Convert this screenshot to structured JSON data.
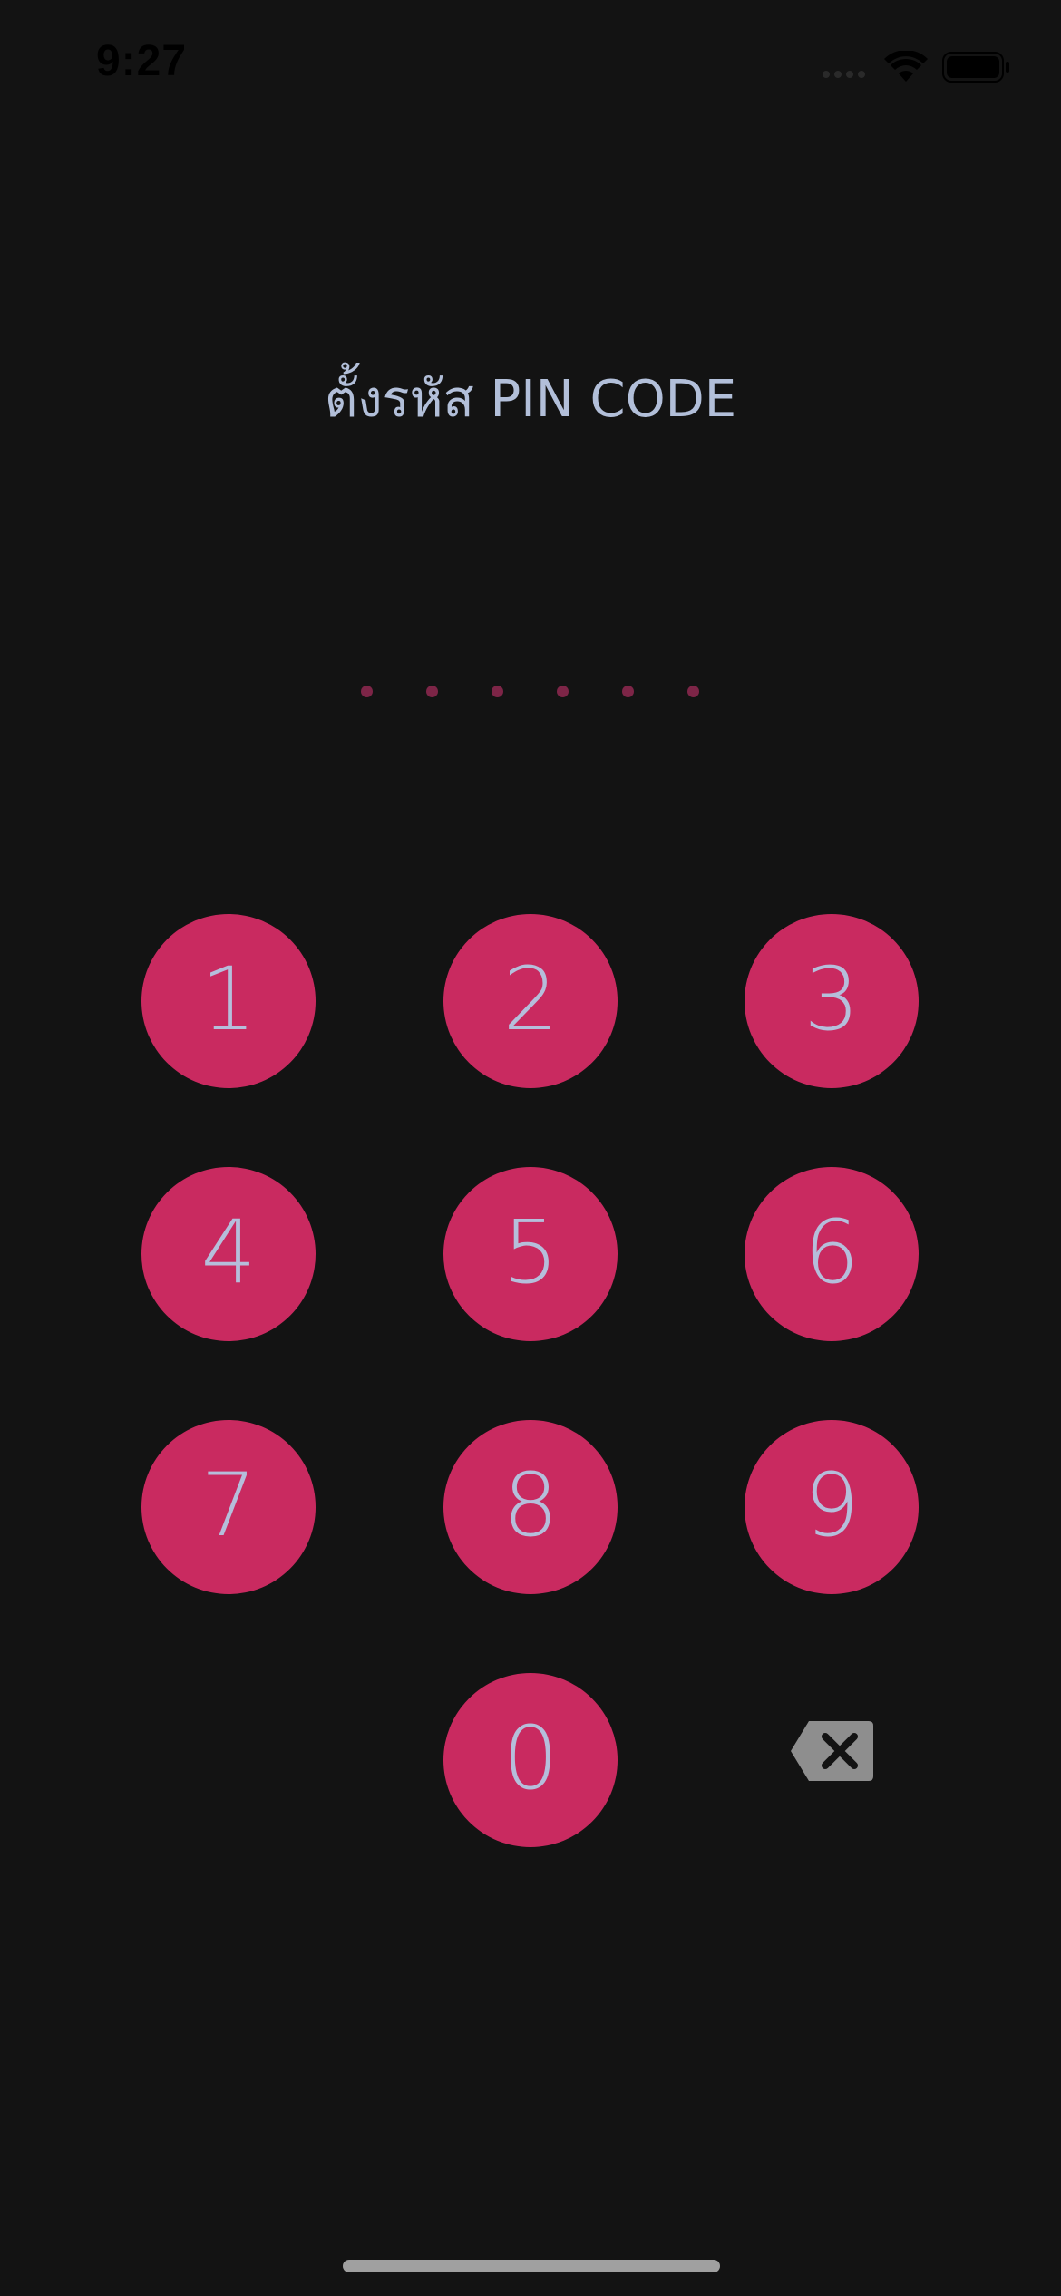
{
  "status_bar": {
    "time": "9:27",
    "icons": [
      "signal-icon",
      "wifi-icon",
      "battery-icon"
    ]
  },
  "title": "ตั้งรหัส PIN CODE",
  "pin": {
    "length": 6,
    "entered": 0
  },
  "keypad": {
    "keys": [
      "1",
      "2",
      "3",
      "4",
      "5",
      "6",
      "7",
      "8",
      "9",
      "0"
    ],
    "delete_icon": "backspace-icon"
  },
  "colors": {
    "background": "#131313",
    "key_fill": "#c92a60",
    "key_text": "#b5bedb",
    "title_text": "#b2bfd9",
    "pin_dot": "#7d2547",
    "delete_icon": "#8e8e8e"
  }
}
